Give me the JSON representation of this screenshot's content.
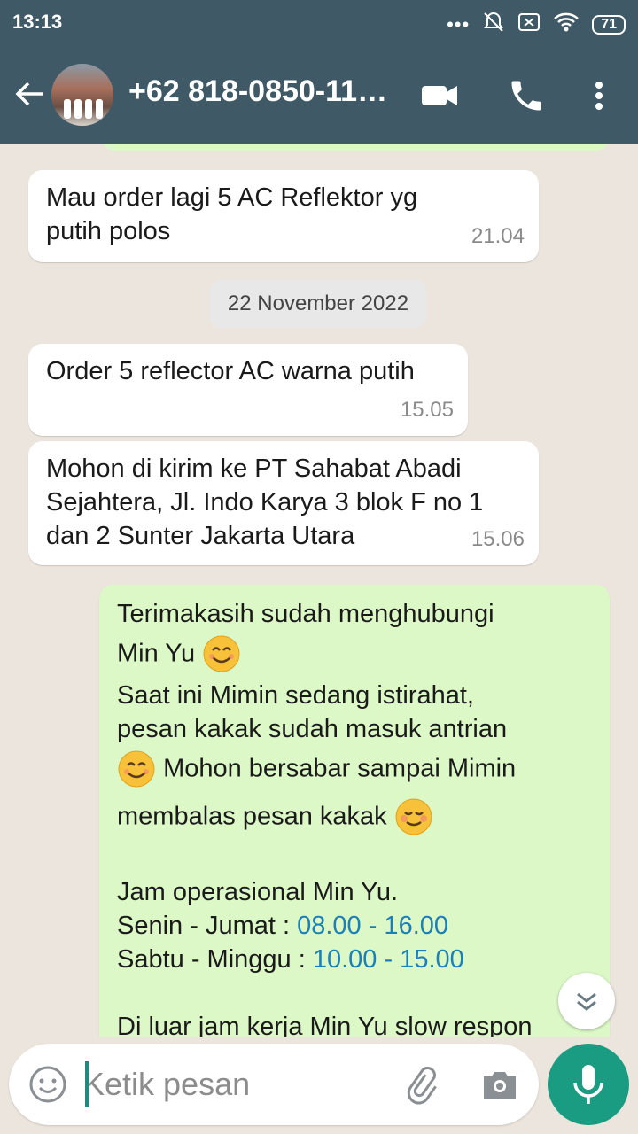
{
  "status_bar": {
    "time": "13:13",
    "battery": "71"
  },
  "header": {
    "contact_name": "+62 818-0850-11…"
  },
  "messages": [
    {
      "lines": [
        "Mau order lagi 5 AC Reflektor yg",
        "putih polos"
      ],
      "time": "21.04"
    },
    {
      "lines": [
        "Order 5 reflector AC warna putih"
      ],
      "time": "15.05"
    },
    {
      "lines": [
        "Mohon di kirim ke PT Sahabat Abadi",
        "Sejahtera, Jl. Indo Karya 3 blok F no 1",
        "dan 2 Sunter Jakarta Utara"
      ],
      "time": "15.06"
    }
  ],
  "date_separator": "22 November 2022",
  "auto_reply": {
    "line1": "Terimakasih sudah menghubungi",
    "line2": "Min Yu",
    "line3": "Saat ini Mimin sedang istirahat,",
    "line4": "pesan kakak sudah masuk antrian",
    "line5": "Mohon bersabar sampai Mimin",
    "line6": "membalas pesan kakak",
    "hours_title": "Jam operasional Min Yu.",
    "weekday_label": "Senin - Jumat : ",
    "weekday_hours": "08.00 - 16.00",
    "weekend_label": "Sabtu - Minggu : ",
    "weekend_hours": "10.00 - 15.00",
    "footer": "Di luar jam kerja Min Yu slow respon"
  },
  "composer": {
    "placeholder": "Ketik pesan"
  },
  "icons": {
    "back": "arrow-left-icon",
    "video": "video-call-icon",
    "call": "phone-icon",
    "menu": "more-vert-icon",
    "emoji": "emoji-icon",
    "attach": "paperclip-icon",
    "camera": "camera-icon",
    "mic": "mic-icon",
    "scroll": "chevron-double-down-icon"
  },
  "colors": {
    "header": "#3f5a66",
    "outgoing_bubble": "#dcf8c6",
    "incoming_bubble": "#ffffff",
    "accent": "#1a9c82",
    "link": "#1b7fb8"
  }
}
